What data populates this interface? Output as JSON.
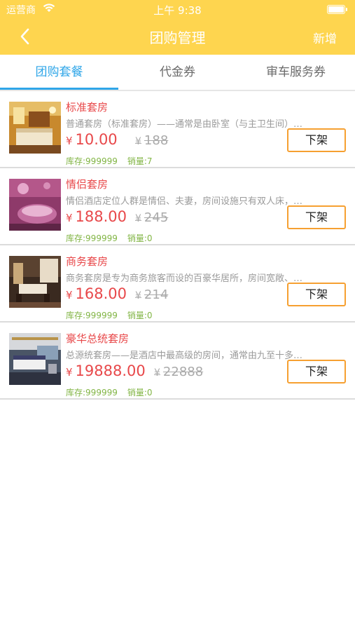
{
  "status_bar": {
    "carrier": "运营商",
    "time": "上午 9:38"
  },
  "nav": {
    "title": "团购管理",
    "action": "新增",
    "back_icon": "chevron-left-icon"
  },
  "tabs": [
    {
      "label": "团购套餐",
      "active": true
    },
    {
      "label": "代金券",
      "active": false
    },
    {
      "label": "审车服务券",
      "active": false
    }
  ],
  "colors": {
    "brand": "#fed54f",
    "tab_active": "#2fa6e8",
    "price": "#e8484a",
    "stock": "#82b545",
    "button_border": "#f6a031"
  },
  "items": [
    {
      "name": "标准套房",
      "desc": "普通套房（标准套房）——通常是由卧室（与主卫生间）…",
      "currency": "¥",
      "price": "10.00",
      "original_price": "188",
      "stock": "库存:999999",
      "sales": "销量:7",
      "button": "下架"
    },
    {
      "name": "情侣套房",
      "desc": "情侣酒店定位人群是情侣、夫妻，房间设施只有双人床，…",
      "currency": "¥",
      "price": "188.00",
      "original_price": "245",
      "stock": "库存:999999",
      "sales": "销量:0",
      "button": "下架"
    },
    {
      "name": "商务套房",
      "desc": "商务套房是专为商务旅客而设的百豪华居所，房间宽敞、…",
      "currency": "¥",
      "price": "168.00",
      "original_price": "214",
      "stock": "库存:999999",
      "sales": "销量:0",
      "button": "下架"
    },
    {
      "name": "豪华总统套房",
      "desc": "总源统套房——是酒店中最高级的房间，通常由九至十多…",
      "currency": "¥",
      "price": "19888.00",
      "original_price": "22888",
      "stock": "库存:999999",
      "sales": "销量:0",
      "button": "下架"
    }
  ]
}
